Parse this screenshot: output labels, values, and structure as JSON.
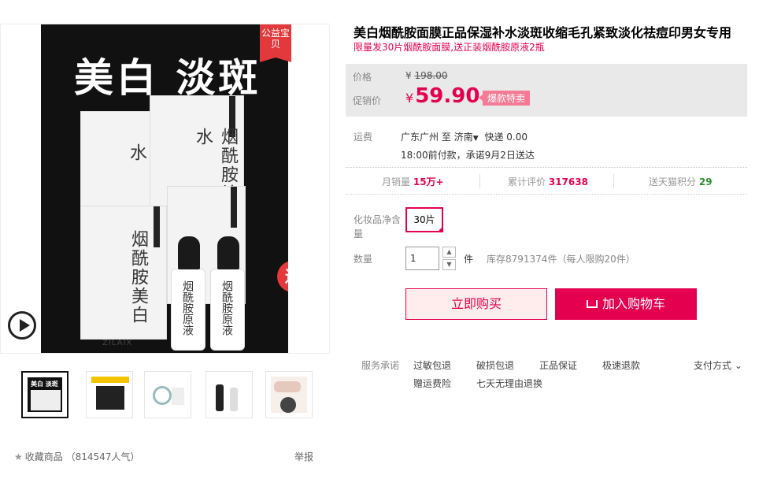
{
  "gallery": {
    "badge": "公益宝贝",
    "hero_text": "美白 淡斑",
    "product_labels": [
      "烟酰胺补水",
      "烟酰胺补水",
      "烟酰胺美白",
      "烟酰胺原液",
      "烟酰胺原液"
    ],
    "gift_label": "送",
    "brand": "ZILAIX",
    "thumbnail_head": "美白 淡斑"
  },
  "product": {
    "title": "美白烟酰胺面膜正品保湿补水淡斑收缩毛孔紧致淡化祛痘印男女专用",
    "subtitle": "限量发30片烟酰胺面膜,送正装烟酰胺原液2瓶"
  },
  "price": {
    "orig_label": "价格",
    "currency": "¥",
    "orig_value": "198.00",
    "promo_label": "促销价",
    "promo_value": "59.90",
    "tag": "爆款特卖"
  },
  "shipping": {
    "label": "运费",
    "from": "广东广州",
    "to_word": "至",
    "to": "济南",
    "fee": "快递 0.00",
    "promise": "18:00前付款，承诺9月2日送达"
  },
  "stats": {
    "sales_label": "月销量",
    "sales_value": "15万+",
    "reviews_label": "累计评价",
    "reviews_value": "317638",
    "points_label": "送天猫积分",
    "points_value": "29"
  },
  "sku": {
    "label": "化妆品净含量",
    "option": "30片"
  },
  "quantity": {
    "label": "数量",
    "value": "1",
    "unit": "件",
    "stock": "库存8791374件（每人限购20件）"
  },
  "actions": {
    "buy": "立即购买",
    "cart": "加入购物车"
  },
  "services": {
    "label": "服务承诺",
    "items": [
      "过敏包退",
      "破损包退",
      "正品保证",
      "极速退款",
      "赠运费险",
      "七天无理由退换"
    ],
    "payment": "支付方式"
  },
  "footer": {
    "favorite": "收藏商品",
    "popularity": "（814547人气）",
    "report": "举报"
  }
}
